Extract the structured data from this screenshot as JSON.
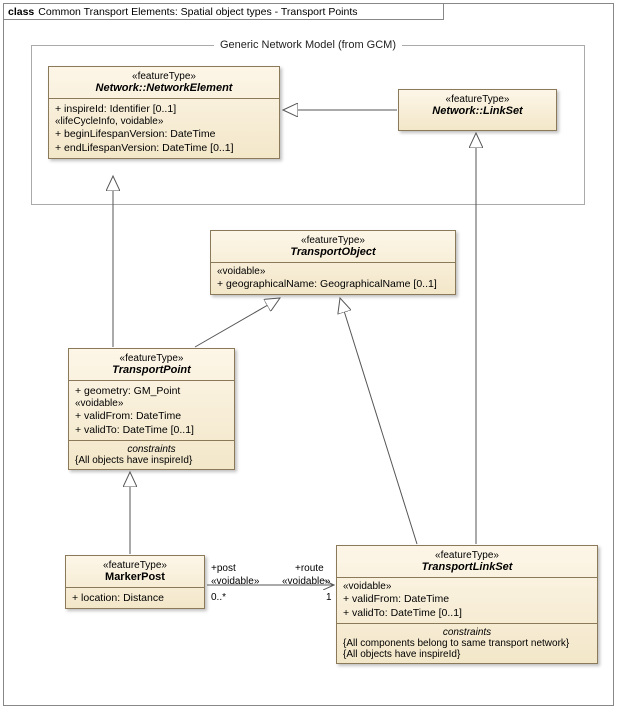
{
  "frame": {
    "keyword": "class",
    "title": "Common Transport Elements: Spatial object types - Transport Points"
  },
  "package": {
    "label": "Generic Network Model (from GCM)"
  },
  "classes": {
    "networkElement": {
      "stereotype": "«featureType»",
      "name": "Network::NetworkElement",
      "attrs": {
        "a1": "+   inspireId: Identifier [0..1]",
        "group": "«lifeCycleInfo, voidable»",
        "a2": "+   beginLifespanVersion: DateTime",
        "a3": "+   endLifespanVersion: DateTime [0..1]"
      }
    },
    "linkSet": {
      "stereotype": "«featureType»",
      "name": "Network::LinkSet"
    },
    "transportObject": {
      "stereotype": "«featureType»",
      "name": "TransportObject",
      "group": "«voidable»",
      "a1": "+   geographicalName: GeographicalName [0..1]"
    },
    "transportPoint": {
      "stereotype": "«featureType»",
      "name": "TransportPoint",
      "a1": "+   geometry: GM_Point",
      "group": "«voidable»",
      "a2": "+   validFrom: DateTime",
      "a3": "+   validTo: DateTime [0..1]",
      "constraintsTitle": "constraints",
      "c1": "{All objects have inspireId}"
    },
    "markerPost": {
      "stereotype": "«featureType»",
      "name": "MarkerPost",
      "a1": "+   location: Distance"
    },
    "transportLinkSet": {
      "stereotype": "«featureType»",
      "name": "TransportLinkSet",
      "group": "«voidable»",
      "a1": "+   validFrom: DateTime",
      "a2": "+   validTo: DateTime [0..1]",
      "constraintsTitle": "constraints",
      "c1": "{All components belong to same transport network}",
      "c2": "{All objects have inspireId}"
    }
  },
  "assoc": {
    "postRole": "+post",
    "postStereo": "«voidable»",
    "postMult": "0..*",
    "routeRole": "+route",
    "routeStereo": "«voidable»",
    "routeMult": "1"
  }
}
